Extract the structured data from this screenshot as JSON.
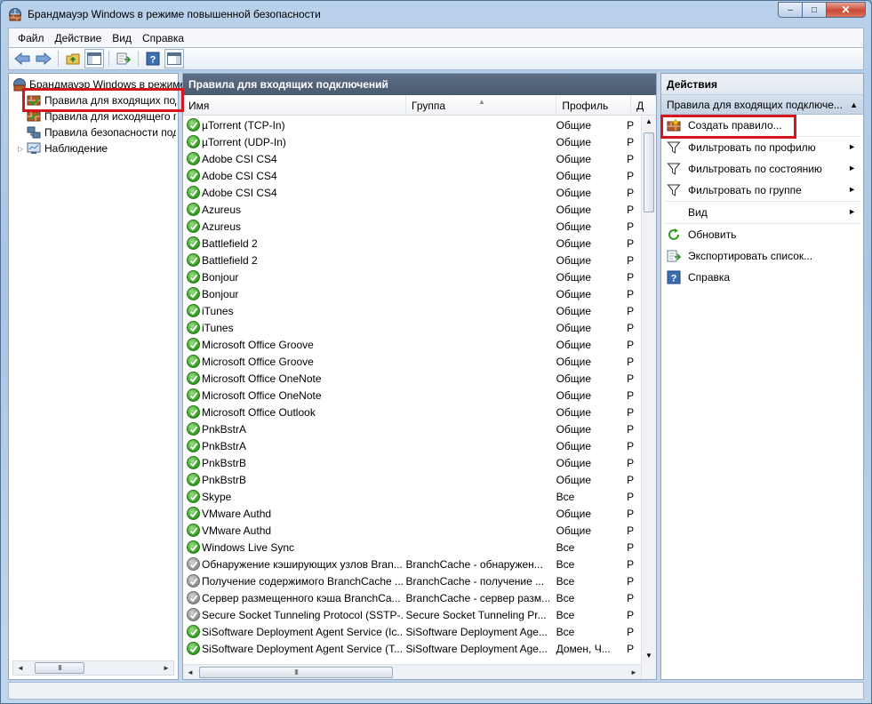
{
  "window": {
    "title": "Брандмауэр Windows в режиме повышенной безопасности",
    "minimize_glyph": "–",
    "maximize_glyph": "□",
    "close_glyph": "✕"
  },
  "menu": [
    {
      "label": "Файл"
    },
    {
      "label": "Действие"
    },
    {
      "label": "Вид"
    },
    {
      "label": "Справка"
    }
  ],
  "toolbar": {
    "icons": [
      "back-icon",
      "forward-icon",
      "up-folder-icon",
      "show-hide-tree-icon",
      "export-icon",
      "help-icon",
      "show-hide-action-pane-icon"
    ]
  },
  "tree": {
    "items": [
      {
        "label": "Брандмауэр Windows в режиме повышенной безопасности",
        "icon": "firewall-icon",
        "level": 0
      },
      {
        "label": "Правила для входящих подключений",
        "icon": "inbound-rules-icon",
        "level": 1,
        "selected": true
      },
      {
        "label": "Правила для исходящего подключения",
        "icon": "outbound-rules-icon",
        "level": 1
      },
      {
        "label": "Правила безопасности подключения",
        "icon": "connection-security-icon",
        "level": 1
      },
      {
        "label": "Наблюдение",
        "icon": "monitoring-icon",
        "level": 1,
        "expander": "▷"
      }
    ]
  },
  "list": {
    "header": "Правила для входящих подключений",
    "columns": [
      "Имя",
      "Группа",
      "Профиль",
      "Д"
    ],
    "rows": [
      {
        "name": "µTorrent (TCP-In)",
        "group": "",
        "profile": "Общие",
        "action": "Р",
        "enabled": true
      },
      {
        "name": "µTorrent (UDP-In)",
        "group": "",
        "profile": "Общие",
        "action": "Р",
        "enabled": true
      },
      {
        "name": "Adobe CSI CS4",
        "group": "",
        "profile": "Общие",
        "action": "Р",
        "enabled": true
      },
      {
        "name": "Adobe CSI CS4",
        "group": "",
        "profile": "Общие",
        "action": "Р",
        "enabled": true
      },
      {
        "name": "Adobe CSI CS4",
        "group": "",
        "profile": "Общие",
        "action": "Р",
        "enabled": true
      },
      {
        "name": "Azureus",
        "group": "",
        "profile": "Общие",
        "action": "Р",
        "enabled": true
      },
      {
        "name": "Azureus",
        "group": "",
        "profile": "Общие",
        "action": "Р",
        "enabled": true
      },
      {
        "name": "Battlefield 2",
        "group": "",
        "profile": "Общие",
        "action": "Р",
        "enabled": true
      },
      {
        "name": "Battlefield 2",
        "group": "",
        "profile": "Общие",
        "action": "Р",
        "enabled": true
      },
      {
        "name": "Bonjour",
        "group": "",
        "profile": "Общие",
        "action": "Р",
        "enabled": true
      },
      {
        "name": "Bonjour",
        "group": "",
        "profile": "Общие",
        "action": "Р",
        "enabled": true
      },
      {
        "name": "iTunes",
        "group": "",
        "profile": "Общие",
        "action": "Р",
        "enabled": true
      },
      {
        "name": "iTunes",
        "group": "",
        "profile": "Общие",
        "action": "Р",
        "enabled": true
      },
      {
        "name": "Microsoft Office Groove",
        "group": "",
        "profile": "Общие",
        "action": "Р",
        "enabled": true
      },
      {
        "name": "Microsoft Office Groove",
        "group": "",
        "profile": "Общие",
        "action": "Р",
        "enabled": true
      },
      {
        "name": "Microsoft Office OneNote",
        "group": "",
        "profile": "Общие",
        "action": "Р",
        "enabled": true
      },
      {
        "name": "Microsoft Office OneNote",
        "group": "",
        "profile": "Общие",
        "action": "Р",
        "enabled": true
      },
      {
        "name": "Microsoft Office Outlook",
        "group": "",
        "profile": "Общие",
        "action": "Р",
        "enabled": true
      },
      {
        "name": "PnkBstrA",
        "group": "",
        "profile": "Общие",
        "action": "Р",
        "enabled": true
      },
      {
        "name": "PnkBstrA",
        "group": "",
        "profile": "Общие",
        "action": "Р",
        "enabled": true
      },
      {
        "name": "PnkBstrB",
        "group": "",
        "profile": "Общие",
        "action": "Р",
        "enabled": true
      },
      {
        "name": "PnkBstrB",
        "group": "",
        "profile": "Общие",
        "action": "Р",
        "enabled": true
      },
      {
        "name": "Skype",
        "group": "",
        "profile": "Все",
        "action": "Р",
        "enabled": true
      },
      {
        "name": "VMware Authd",
        "group": "",
        "profile": "Общие",
        "action": "Р",
        "enabled": true
      },
      {
        "name": "VMware Authd",
        "group": "",
        "profile": "Общие",
        "action": "Р",
        "enabled": true
      },
      {
        "name": "Windows Live Sync",
        "group": "",
        "profile": "Все",
        "action": "Р",
        "enabled": true
      },
      {
        "name": "Обнаружение кэширующих узлов Bran...",
        "group": "BranchCache - обнаружен...",
        "profile": "Все",
        "action": "Р",
        "enabled": false
      },
      {
        "name": "Получение содержимого BranchCache ...",
        "group": "BranchCache - получение ...",
        "profile": "Все",
        "action": "Р",
        "enabled": false
      },
      {
        "name": "Сервер размещенного кэша BranchCa...",
        "group": "BranchCache - сервер разм...",
        "profile": "Все",
        "action": "Р",
        "enabled": false
      },
      {
        "name": "Secure Socket Tunneling Protocol (SSTP-...",
        "group": "Secure Socket Tunneling Pr...",
        "profile": "Все",
        "action": "Р",
        "enabled": false
      },
      {
        "name": "SiSoftware Deployment Agent Service (Ic...",
        "group": "SiSoftware Deployment Age...",
        "profile": "Все",
        "action": "Р",
        "enabled": true
      },
      {
        "name": "SiSoftware Deployment Agent Service (T...",
        "group": "SiSoftware Deployment Age...",
        "profile": "Домен, Ч...",
        "action": "Р",
        "enabled": true
      }
    ]
  },
  "actions": {
    "title": "Действия",
    "section": "Правила для входящих подключе...",
    "section_arrow": "▲",
    "items": [
      {
        "label": "Создать правило...",
        "icon": "new-rule-icon",
        "submenu": false
      },
      {
        "label": "Фильтровать по профилю",
        "icon": "filter-icon",
        "submenu": true
      },
      {
        "label": "Фильтровать по состоянию",
        "icon": "filter-icon",
        "submenu": true
      },
      {
        "label": "Фильтровать по группе",
        "icon": "filter-icon",
        "submenu": true
      },
      {
        "label": "Вид",
        "icon": "",
        "submenu": true
      },
      {
        "label": "Обновить",
        "icon": "refresh-icon",
        "submenu": false
      },
      {
        "label": "Экспортировать список...",
        "icon": "export-list-icon",
        "submenu": false
      },
      {
        "label": "Справка",
        "icon": "help-icon",
        "submenu": false
      }
    ]
  },
  "colors": {
    "highlight_box": "#d6161e",
    "enabled_rule": "#2f9a1d",
    "disabled_rule": "#8a8a8a",
    "pane_header": "#4a5a6f"
  },
  "scroll_glyphs": {
    "left": "◄",
    "right": "►",
    "up": "▲",
    "down": "▼",
    "grip": "III"
  }
}
